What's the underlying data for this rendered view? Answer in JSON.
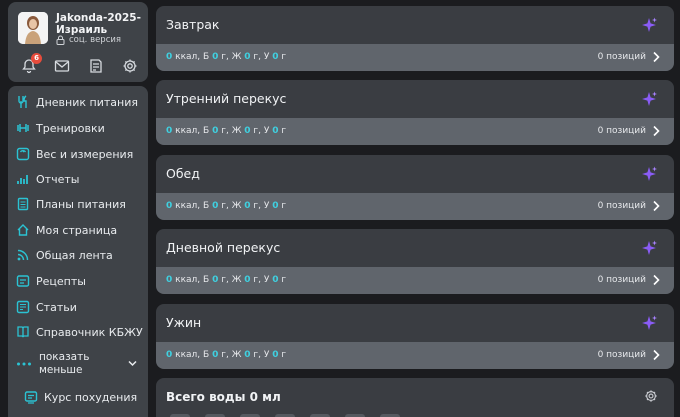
{
  "user": {
    "name": "Jakonda-2025-Израиль",
    "version": "соц. версия"
  },
  "notifications": {
    "count": "6"
  },
  "menu": [
    {
      "label": "Дневник питания",
      "icon": "utensils-icon"
    },
    {
      "label": "Тренировки",
      "icon": "dumbbell-icon"
    },
    {
      "label": "Вес и измерения",
      "icon": "scale-icon"
    },
    {
      "label": "Отчеты",
      "icon": "bar-chart-icon"
    },
    {
      "label": "Планы питания",
      "icon": "document-icon"
    },
    {
      "label": "Моя страница",
      "icon": "home-icon"
    },
    {
      "label": "Общая лента",
      "icon": "feed-icon"
    },
    {
      "label": "Рецепты",
      "icon": "recipe-icon"
    },
    {
      "label": "Статьи",
      "icon": "article-icon"
    },
    {
      "label": "Справочник КБЖУ",
      "icon": "book-icon"
    },
    {
      "label": "показать меньше",
      "icon": "dots-icon"
    },
    {
      "label": "Курс похудения",
      "icon": "course-icon"
    }
  ],
  "meals": [
    {
      "title": "Завтрак",
      "kcal": "0",
      "b": "0",
      "zh": "0",
      "u": "0",
      "positions": "0 позиций"
    },
    {
      "title": "Утренний перекус",
      "kcal": "0",
      "b": "0",
      "zh": "0",
      "u": "0",
      "positions": "0 позиций"
    },
    {
      "title": "Обед",
      "kcal": "0",
      "b": "0",
      "zh": "0",
      "u": "0",
      "positions": "0 позиций"
    },
    {
      "title": "Дневной перекус",
      "kcal": "0",
      "b": "0",
      "zh": "0",
      "u": "0",
      "positions": "0 позиций"
    },
    {
      "title": "Ужин",
      "kcal": "0",
      "b": "0",
      "zh": "0",
      "u": "0",
      "positions": "0 позиций"
    }
  ],
  "labels": {
    "kcal": "ккал",
    "b": "Б",
    "zh": "Ж",
    "u": "У",
    "g": "г"
  },
  "water": {
    "title": "Всего воды 0 мл"
  },
  "colors": {
    "accent": "#3fd0e0",
    "sparkle": "#8a5cf6",
    "badge": "#e74c3c"
  }
}
